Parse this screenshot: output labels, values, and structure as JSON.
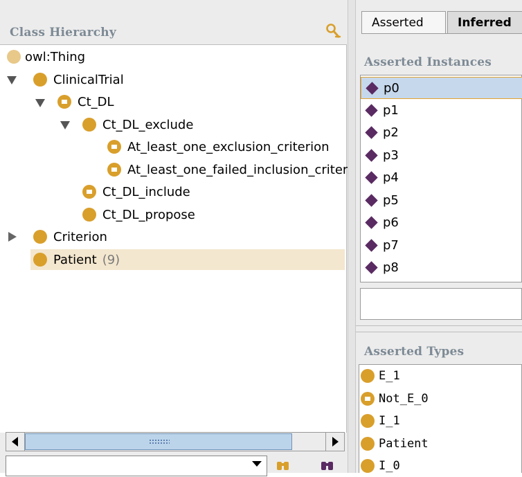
{
  "class_hierarchy": {
    "title": "Class Hierarchy",
    "find_icon": "search-person-icon",
    "nodes": [
      {
        "label": "owl:Thing",
        "icon": "class-light-icon"
      },
      {
        "label": "ClinicalTrial",
        "icon": "class-icon",
        "toggle": "expanded"
      },
      {
        "label": "Ct_DL",
        "icon": "defined-class-icon",
        "toggle": "expanded"
      },
      {
        "label": "Ct_DL_exclude",
        "icon": "class-icon",
        "toggle": "expanded"
      },
      {
        "label": "At_least_one_exclusion_criterion",
        "icon": "defined-class-icon"
      },
      {
        "label": "At_least_one_failed_inclusion_criterion",
        "icon": "defined-class-icon"
      },
      {
        "label": "Ct_DL_include",
        "icon": "defined-class-icon"
      },
      {
        "label": "Ct_DL_propose",
        "icon": "class-icon"
      },
      {
        "label": "Criterion",
        "icon": "class-icon",
        "toggle": "collapsed"
      },
      {
        "label": "Patient",
        "icon": "class-icon",
        "count": "(9)",
        "selected": true
      }
    ],
    "search_value": ""
  },
  "instances": {
    "tabs": [
      {
        "label": "Asserted",
        "active": true
      },
      {
        "label": "Inferred",
        "active": false
      }
    ],
    "title": "Asserted Instances",
    "items": [
      "p0",
      "p1",
      "p2",
      "p3",
      "p4",
      "p5",
      "p6",
      "p7",
      "p8"
    ],
    "selected": "p0"
  },
  "types": {
    "title": "Asserted Types",
    "items": [
      {
        "label": "E_1",
        "icon": "class-icon"
      },
      {
        "label": "Not_E_0",
        "icon": "defined-class-icon"
      },
      {
        "label": "I_1",
        "icon": "class-icon"
      },
      {
        "label": "Patient",
        "icon": "class-icon"
      },
      {
        "label": "I_0",
        "icon": "class-icon"
      }
    ]
  },
  "colors": {
    "class": "#d99f2b",
    "individual": "#5a2a62",
    "selection": "#c6d8ec",
    "title_text": "#7d8a95"
  }
}
